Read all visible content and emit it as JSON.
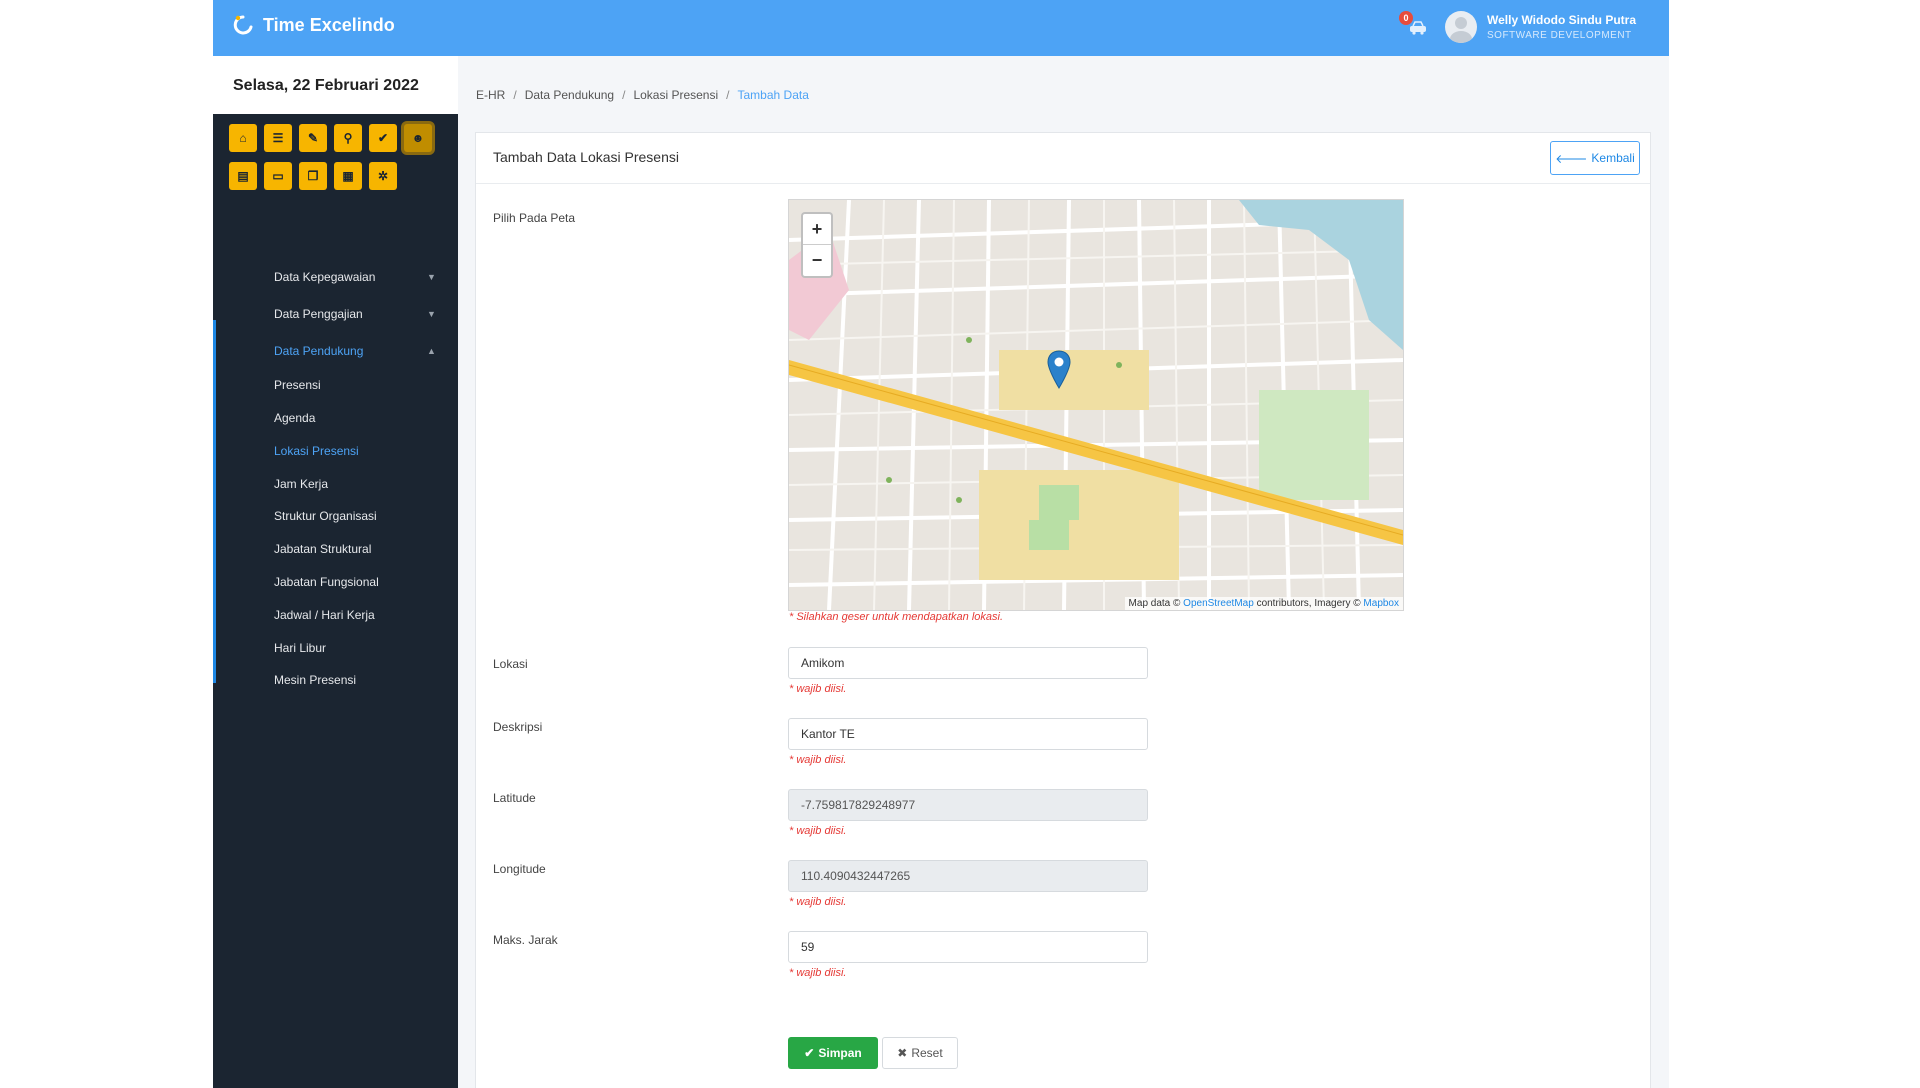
{
  "app": {
    "brand": "Time Excelindo"
  },
  "header": {
    "notification_count": "0",
    "user_name": "Welly Widodo Sindu Putra",
    "user_role": "SOFTWARE DEVELOPMENT"
  },
  "sidebar": {
    "date": "Selasa, 22 Februari 2022",
    "tools": [
      {
        "icon": "home-icon",
        "glyph": "⌂"
      },
      {
        "icon": "list-icon",
        "glyph": "☰"
      },
      {
        "icon": "edit-icon",
        "glyph": "✎"
      },
      {
        "icon": "search-icon",
        "glyph": "⚲"
      },
      {
        "icon": "check-icon",
        "glyph": "✔"
      },
      {
        "icon": "user-icon",
        "glyph": "☻"
      },
      {
        "icon": "document-icon",
        "glyph": "▤"
      },
      {
        "icon": "card-icon",
        "glyph": "▭"
      },
      {
        "icon": "files-icon",
        "glyph": "❐"
      },
      {
        "icon": "chart-icon",
        "glyph": "▦"
      },
      {
        "icon": "settings-icon",
        "glyph": "✲"
      }
    ],
    "menu": {
      "kepegawaian": "Data Kepegawaian",
      "penggajian": "Data Penggajian",
      "pendukung": "Data Pendukung",
      "presensi": "Presensi",
      "agenda": "Agenda",
      "lokasi_presensi": "Lokasi Presensi",
      "jam_kerja": "Jam Kerja",
      "struktur_organisasi": "Struktur Organisasi",
      "jabatan_struktural": "Jabatan Struktural",
      "jabatan_fungsional": "Jabatan Fungsional",
      "jadwal_hari_kerja": "Jadwal / Hari Kerja",
      "hari_libur": "Hari Libur",
      "mesin_presensi": "Mesin Presensi"
    }
  },
  "breadcrumb": {
    "items": [
      "E-HR",
      "Data Pendukung",
      "Lokasi Presensi",
      "Tambah Data"
    ],
    "separator": "/"
  },
  "card": {
    "title": "Tambah Data Lokasi Presensi",
    "back_label": "Kembali"
  },
  "form": {
    "map_label": "Pilih Pada Peta",
    "map_note": "* Silahkan geser untuk mendapatkan lokasi.",
    "map_attribution": {
      "prefix": "Map data ©",
      "osm": "OpenStreetMap",
      "middle": "contributors, Imagery ©",
      "mapbox": "Mapbox"
    },
    "zoom_in": "+",
    "zoom_out": "−",
    "required_note": "* wajib diisi.",
    "lokasi_label": "Lokasi",
    "lokasi_value": "Amikom",
    "deskripsi_label": "Deskripsi",
    "deskripsi_value": "Kantor TE",
    "latitude_label": "Latitude",
    "latitude_value": "-7.759817829248977",
    "longitude_label": "Longitude",
    "longitude_value": "110.4090432447265",
    "maks_jarak_label": "Maks. Jarak",
    "maks_jarak_value": "59",
    "save_label": "Simpan",
    "reset_label": "Reset"
  },
  "colors": {
    "topbar": "#4da3f5",
    "sidebar": "#1b2531",
    "tool_button": "#f7b500",
    "accent": "#1e88e5",
    "save": "#28a745",
    "required": "#e53935"
  }
}
